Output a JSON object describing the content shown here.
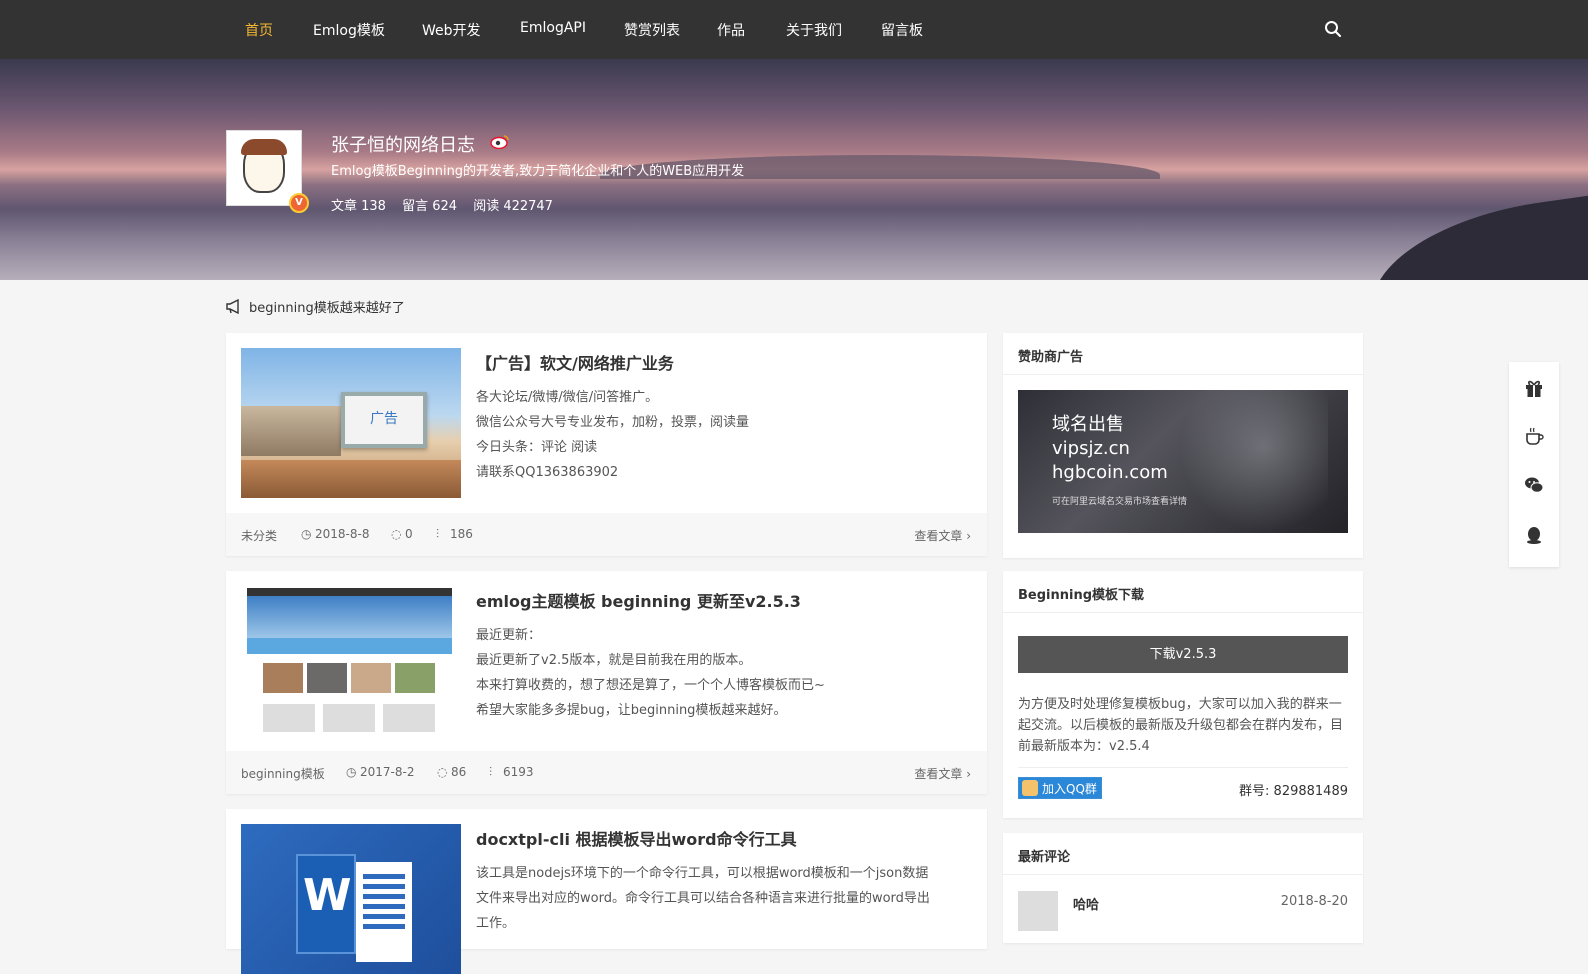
{
  "nav": {
    "items": [
      "首页",
      "Emlog模板",
      "Web开发",
      "EmlogAPI",
      "赞赏列表",
      "作品",
      "关于我们",
      "留言板"
    ],
    "active_index": 0,
    "search_icon": "search-icon"
  },
  "profile": {
    "title": "张子恒的网络日志",
    "description": "Emlog模板Beginning的开发者,致力于简化企业和个人的WEB应用开发",
    "stats": {
      "articles": "文章 138",
      "comments": "留言 624",
      "views": "阅读 422747"
    },
    "badge": "V"
  },
  "notice": {
    "icon": "megaphone-icon",
    "text": "beginning模板越来越好了"
  },
  "articles": [
    {
      "title": "【广告】软文/网络推广业务",
      "thumb_label": "广告",
      "excerpt": [
        "各大论坛/微博/微信/问答推广。",
        "微信公众号大号专业发布，加粉，投票，阅读量",
        "今日头条：评论 阅读",
        "请联系QQ1363863902"
      ],
      "category": "未分类",
      "date": "2018-8-8",
      "comments": "0",
      "views": "186",
      "read_more": "查看文章"
    },
    {
      "title": "emlog主题模板 beginning 更新至v2.5.3",
      "thumb_label": "",
      "excerpt": [
        "最近更新：",
        "最近更新了v2.5版本，就是目前我在用的版本。",
        "本来打算收费的，想了想还是算了，一个个人博客模板而已~",
        "希望大家能多多提bug，让beginning模板越来越好。"
      ],
      "category": "beginning模板",
      "date": "2017-8-2",
      "comments": "86",
      "views": "6193",
      "read_more": "查看文章"
    },
    {
      "title": "docxtpl-cli 根据模板导出word命令行工具",
      "thumb_label": "W",
      "excerpt": [
        "该工具是nodejs环境下的一个命令行工具，可以根据word模板和一个json数据",
        "文件来导出对应的word。命令行工具可以结合各种语言来进行批量的word导出",
        "工作。"
      ],
      "category": "",
      "date": "",
      "comments": "",
      "views": "",
      "read_more": ""
    }
  ],
  "sidebar": {
    "sponsor": {
      "title": "赞助商广告",
      "lines": [
        "域名出售",
        "vipsjz.cn",
        "hgbcoin.com",
        "可在阿里云域名交易市场查看详情"
      ]
    },
    "download": {
      "title": "Beginning模板下载",
      "button": "下载v2.5.3",
      "text": "为方便及时处理修复模板bug，大家可以加入我的群来一起交流。以后模板的最新版及升级包都会在群内发布，目前最新版本为：v2.5.4",
      "qq_button": "加入QQ群",
      "group_no": "群号: 829881489"
    },
    "comments": {
      "title": "最新评论",
      "name": "哈哈",
      "date": "2018-8-20"
    }
  },
  "floatbar": [
    "gift-icon",
    "coffee-icon",
    "wechat-icon",
    "qq-icon"
  ],
  "colors": {
    "nav_bg": "#333333",
    "nav_active": "#f5b733",
    "accent_blue": "#2b88d8"
  }
}
